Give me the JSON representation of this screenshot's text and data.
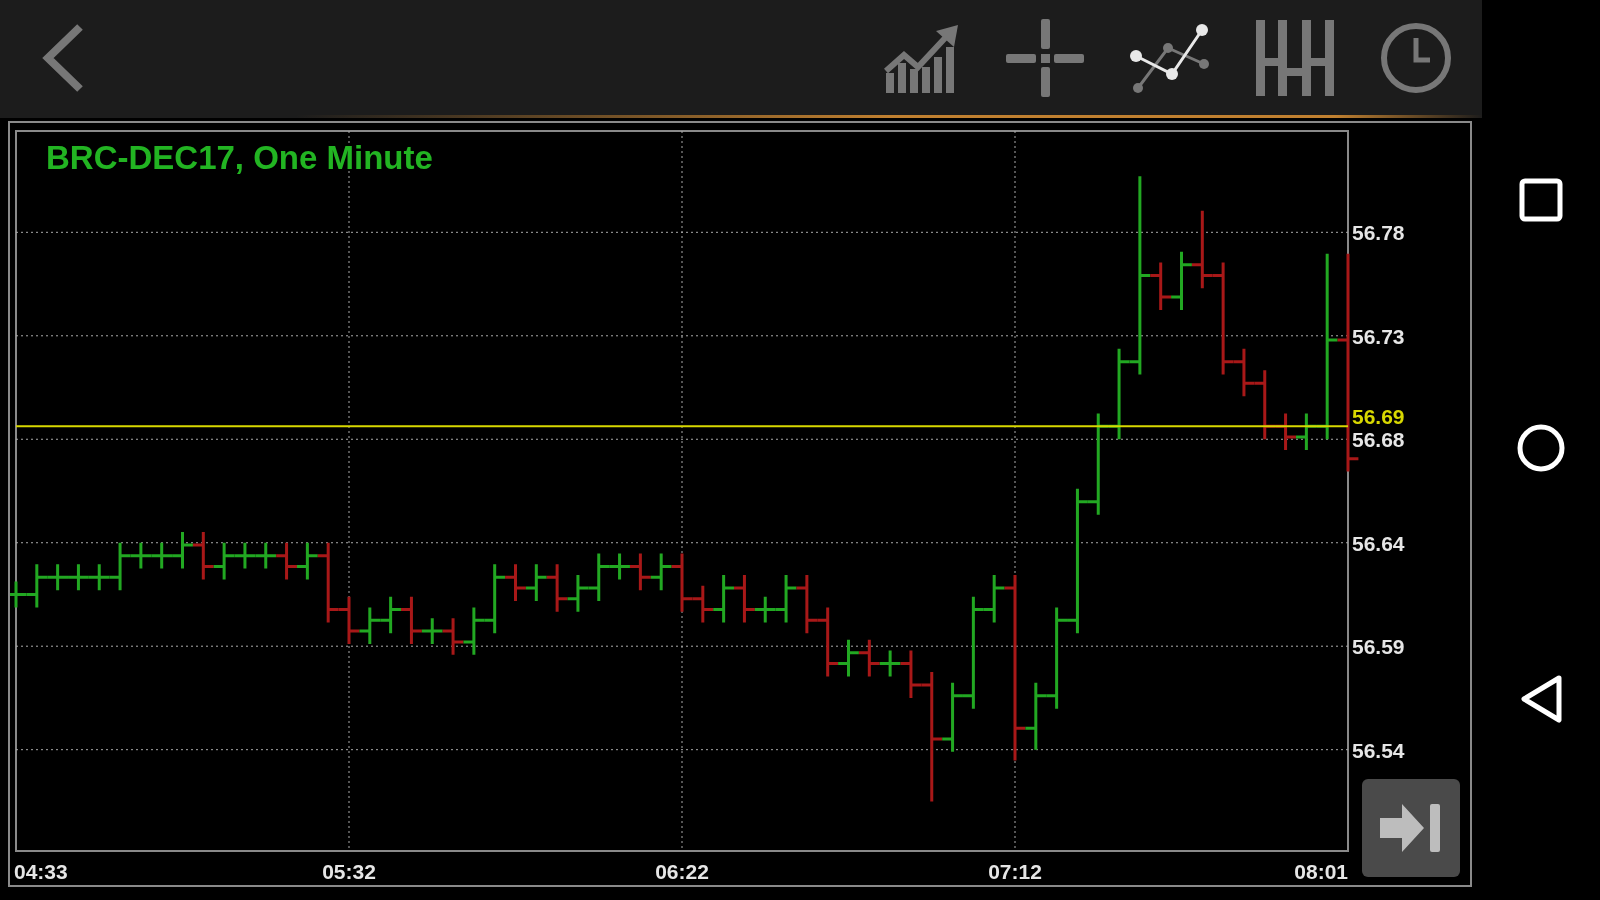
{
  "toolbar": {
    "tools": [
      {
        "kind": "back",
        "selected": false
      },
      {
        "kind": "indicators",
        "selected": false
      },
      {
        "kind": "crosshair",
        "selected": false
      },
      {
        "kind": "trendline",
        "selected": true
      },
      {
        "kind": "bar-type",
        "selected": false
      },
      {
        "kind": "interval",
        "selected": false
      }
    ]
  },
  "chart": {
    "title": "BRC-DEC17, One Minute",
    "price_labels": [
      "56.78",
      "56.73",
      "56.68",
      "56.64",
      "56.59",
      "56.54"
    ],
    "time_labels": [
      "04:33",
      "05:32",
      "06:22",
      "07:12",
      "08:01"
    ],
    "last_price": "56.69"
  }
}
